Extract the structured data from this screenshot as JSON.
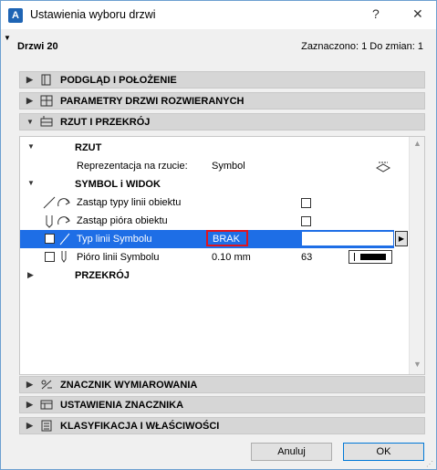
{
  "window": {
    "title": "Ustawienia wyboru drzwi",
    "help_label": "?",
    "close_label": "✕"
  },
  "header": {
    "element_name": "Drzwi 20",
    "status": "Zaznaczono: 1 Do zmian: 1"
  },
  "sections": {
    "preview": "PODGLĄD I POŁOŻENIE",
    "params": "PARAMETRY DRZWI ROZWIERANYCH",
    "plan": "RZUT I PRZEKRÓJ",
    "dimension": "ZNACZNIK WYMIAROWANIA",
    "marker": "USTAWIENIA ZNACZNIKA",
    "classification": "KLASYFIKACJA I WŁAŚCIWOŚCI"
  },
  "plan_panel": {
    "rzut": {
      "heading": "RZUT",
      "representation_label": "Reprezentacja na rzucie:",
      "representation_value": "Symbol"
    },
    "symbol": {
      "heading": "SYMBOL i WIDOK",
      "override_line_types": "Zastąp typy linii obiektu",
      "override_pens": "Zastąp pióra obiektu",
      "line_type_label": "Typ linii Symbolu",
      "line_type_value": "BRAK",
      "pen_label": "Pióro linii Symbolu",
      "pen_thickness": "0.10 mm",
      "pen_number": "63"
    },
    "section_heading": "PRZEKRÓJ"
  },
  "buttons": {
    "cancel": "Anuluj",
    "ok": "OK"
  },
  "colors": {
    "selection": "#1e6ee6",
    "highlight_border": "#e0141e",
    "section_bg": "#d6d6d6"
  }
}
